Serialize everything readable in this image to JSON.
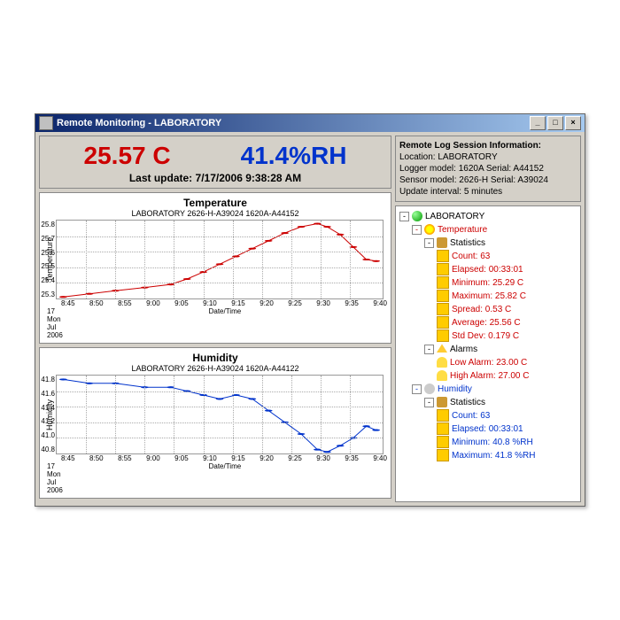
{
  "window": {
    "title": "Remote Monitoring - LABORATORY"
  },
  "readings": {
    "temperature": "25.57 C",
    "humidity": "41.4%RH",
    "last_update_label": "Last update: 7/17/2006 9:38:28 AM"
  },
  "info": {
    "header": "Remote Log Session Information:",
    "location": "Location: LABORATORY",
    "logger": "Logger model: 1620A  Serial: A44152",
    "sensor": "Sensor model: 2626-H  Serial: A39024",
    "interval": "Update interval: 5 minutes"
  },
  "charts": {
    "temp": {
      "title": "Temperature",
      "subtitle": "LABORATORY   2626-H-A39024   1620A-A44152",
      "ylabel": "Temperature",
      "xlabel": "Date/Time",
      "date_stamp": "17 Mon Jul 2006"
    },
    "hum": {
      "title": "Humidity",
      "subtitle": "LABORATORY   2626-H-A39024   1620A-A44122",
      "ylabel": "Humidity",
      "xlabel": "Date/Time",
      "date_stamp": "17 Mon Jul 2006"
    },
    "xticks": [
      "8:45",
      "8:50",
      "8:55",
      "9:00",
      "9:05",
      "9:10",
      "9:15",
      "9:20",
      "9:25",
      "9:30",
      "9:35",
      "9:40"
    ],
    "temp_yticks": [
      "25.8",
      "25.7",
      "25.6",
      "25.5",
      "25.4",
      "25.3"
    ],
    "hum_yticks": [
      "41.8",
      "41.6",
      "41.4",
      "41.2",
      "41.0",
      "40.8"
    ]
  },
  "tree": {
    "root": "LABORATORY",
    "temp_label": "Temperature",
    "stats_label": "Statistics",
    "alarms_label": "Alarms",
    "hum_label": "Humidity",
    "temp_stats": {
      "count": "Count: 63",
      "elapsed": "Elapsed: 00:33:01",
      "minimum": "Minimum: 25.29 C",
      "maximum": "Maximum: 25.82 C",
      "spread": "Spread: 0.53 C",
      "average": "Average: 25.56 C",
      "stddev": "Std Dev: 0.179 C"
    },
    "temp_alarms": {
      "low": "Low Alarm: 23.00 C",
      "high": "High Alarm: 27.00 C"
    },
    "hum_stats": {
      "count": "Count: 63",
      "elapsed": "Elapsed: 00:33:01",
      "minimum": "Minimum: 40.8 %RH",
      "maximum": "Maximum: 41.8 %RH"
    }
  },
  "chart_data": [
    {
      "type": "line",
      "title": "Temperature",
      "xlabel": "Date/Time",
      "ylabel": "Temperature",
      "ylim": [
        25.3,
        25.8
      ],
      "x": [
        "8:45",
        "8:50",
        "8:55",
        "9:00",
        "9:05",
        "9:07",
        "9:10",
        "9:12",
        "9:15",
        "9:17",
        "9:20",
        "9:22",
        "9:25",
        "9:27",
        "9:30",
        "9:32",
        "9:35",
        "9:37",
        "9:40"
      ],
      "values": [
        25.3,
        25.32,
        25.34,
        25.36,
        25.38,
        25.42,
        25.46,
        25.5,
        25.55,
        25.6,
        25.65,
        25.7,
        25.76,
        25.8,
        25.78,
        25.72,
        25.64,
        25.56,
        25.55
      ]
    },
    {
      "type": "line",
      "title": "Humidity",
      "xlabel": "Date/Time",
      "ylabel": "Humidity",
      "ylim": [
        40.8,
        41.8
      ],
      "x": [
        "8:45",
        "8:50",
        "8:55",
        "9:00",
        "9:05",
        "9:07",
        "9:10",
        "9:12",
        "9:15",
        "9:17",
        "9:20",
        "9:22",
        "9:25",
        "9:27",
        "9:30",
        "9:32",
        "9:35",
        "9:37",
        "9:40"
      ],
      "values": [
        41.75,
        41.7,
        41.7,
        41.65,
        41.65,
        41.6,
        41.55,
        41.5,
        41.55,
        41.5,
        41.35,
        41.2,
        41.05,
        40.85,
        40.8,
        40.9,
        41.0,
        41.15,
        41.1
      ]
    }
  ]
}
